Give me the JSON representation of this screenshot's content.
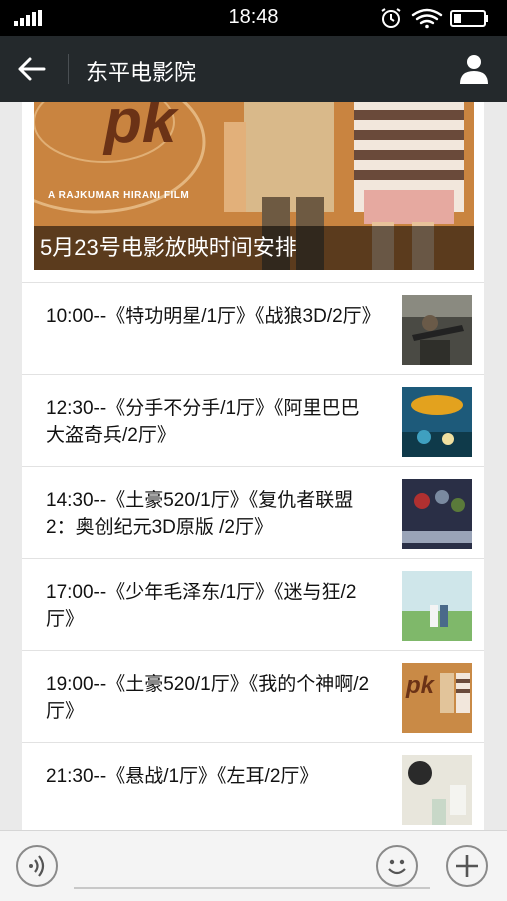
{
  "status_bar": {
    "time": "18:48",
    "icons": [
      "signal-icon",
      "alarm-icon",
      "wifi-icon",
      "battery-icon"
    ]
  },
  "nav": {
    "title": "东平电影院",
    "back_icon": "back-arrow-icon",
    "profile_icon": "person-icon"
  },
  "hero": {
    "credit": "A RAJKUMAR HIRANI FILM",
    "title": "5月23号电影放映时间安排"
  },
  "schedule": [
    {
      "text": "10:00--《特功明星/1厅》《战狼3D/2厅》",
      "thumb_color": "#4a4a44"
    },
    {
      "text": "12:30--《分手不分手/1厅》《阿里巴巴大盗奇兵/2厅》",
      "thumb_color": "#1d5a7a"
    },
    {
      "text": "14:30--《土豪520/1厅》《复仇者联盟2：奥创纪元3D原版 /2厅》",
      "thumb_color": "#2a2f46"
    },
    {
      "text": "17:00--《少年毛泽东/1厅》《迷与狂/2厅》",
      "thumb_color": "#9bc4a6"
    },
    {
      "text": "19:00--《土豪520/1厅》《我的个神啊/2厅》",
      "thumb_color": "#c98a46"
    },
    {
      "text": "21:30--《悬战/1厅》《左耳/2厅》",
      "thumb_color": "#d8d8cc"
    }
  ],
  "bottom_bar": {
    "voice_icon": "voice-icon",
    "emoji_icon": "emoji-icon",
    "add_icon": "plus-icon"
  },
  "colors": {
    "nav_bg": "#24292c",
    "page_bg": "#eaeaea"
  }
}
